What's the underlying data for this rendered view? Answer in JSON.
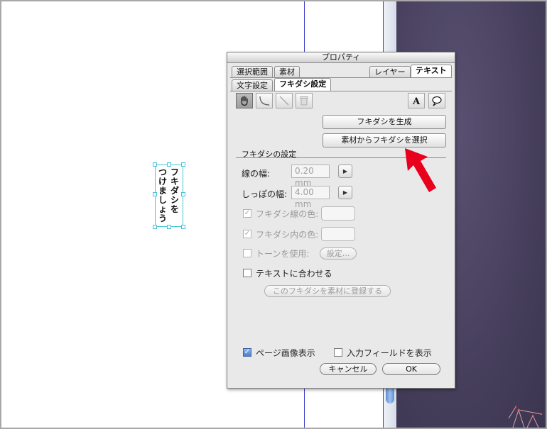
{
  "balloon": {
    "col_right": [
      "フ",
      "キ",
      "ダ",
      "シ",
      "を"
    ],
    "col_left": [
      "つ",
      "け",
      "ま",
      "し",
      "ょ",
      "う"
    ]
  },
  "palette": {
    "title": "プロパティ",
    "tabs_top": [
      "選択範囲",
      "素材",
      "レイヤー",
      "テキスト"
    ],
    "tabs_sub": [
      "文字設定",
      "フキダシ設定"
    ],
    "tool_icons": [
      "hand-icon",
      "curve-icon",
      "line-icon",
      "trash-icon"
    ],
    "right_tool_icons": [
      "text-a-icon",
      "speech-balloon-icon"
    ],
    "create_button": "フキダシを生成",
    "select_from_material_button": "素材からフキダシを選択",
    "section_title": "フキダシの設定",
    "line_width": {
      "label": "線の幅:",
      "value": "0.20 mm"
    },
    "tail_width": {
      "label": "しっぽの幅:",
      "value": "4.00 mm"
    },
    "stroke_color_label": "フキダシ線の色:",
    "fill_color_label": "フキダシ内の色:",
    "tone_label": "トーンを使用:",
    "tone_settings_button": "設定...",
    "fit_text_label": "テキストに合わせる",
    "register_button": "このフキダシを素材に登録する",
    "show_page_image_label": "ページ画像表示",
    "show_input_field_label": "入力フィールドを表示",
    "cancel_button": "キャンセル",
    "ok_button": "OK"
  },
  "colors": {
    "accent": "#e8001c",
    "guide": "#3b3bcc",
    "selection": "#46c3d6"
  }
}
